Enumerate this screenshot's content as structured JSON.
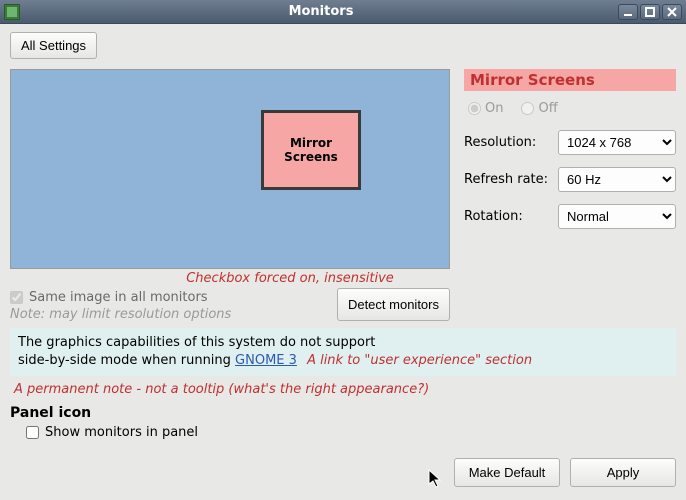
{
  "titlebar": {
    "title": "Monitors"
  },
  "header": {
    "all_settings": "All Settings"
  },
  "preview": {
    "monitor_label": "Mirror Screens"
  },
  "annotations": {
    "checkbox": "Checkbox forced on, insensitive",
    "link": "A link to \"user experience\" section",
    "permanent": "A permanent note - not a tooltip (what's the right appearance?)"
  },
  "same_image": {
    "label": "Same image in all monitors",
    "note": "Note: may limit resolution options"
  },
  "detect_button": "Detect monitors",
  "side": {
    "header": "Mirror Screens",
    "on_label": "On",
    "off_label": "Off",
    "resolution_label": "Resolution:",
    "resolution_value": "1024 x 768",
    "refresh_label": "Refresh rate:",
    "refresh_value": "60 Hz",
    "rotation_label": "Rotation:",
    "rotation_value": "Normal"
  },
  "info": {
    "text_a": "The graphics capabilities of this system do not support",
    "text_b": "side-by-side mode when running ",
    "link_text": "GNOME 3"
  },
  "panel": {
    "heading": "Panel icon",
    "checkbox_label": "Show monitors in panel"
  },
  "buttons": {
    "make_default": "Make Default",
    "apply": "Apply"
  }
}
